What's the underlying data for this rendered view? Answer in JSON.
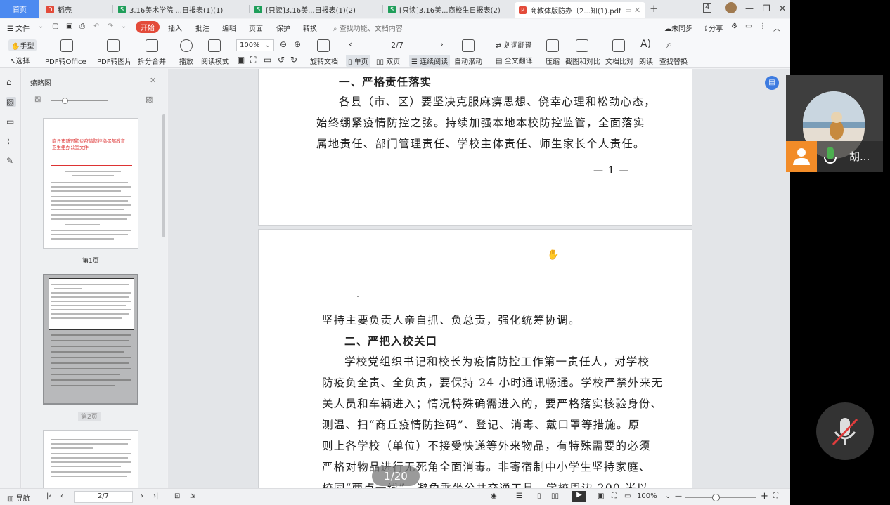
{
  "tabs": [
    {
      "label": "首页",
      "active": false
    },
    {
      "label": "稻壳",
      "active": false
    },
    {
      "label": "3.16美术学院 ...日报表(1)(1)",
      "active": false
    },
    {
      "label": "[只读]3.16美...日报表(1)(2)",
      "active": false
    },
    {
      "label": "[只读]3.16美...商校生日报表(2)",
      "active": false
    },
    {
      "label": "商教体版防办〔2...知(1).pdf",
      "active": true
    }
  ],
  "menubar": {
    "file": "文件",
    "start": "开始",
    "insert": "插入",
    "annotate": "批注",
    "edit": "编辑",
    "page": "页面",
    "protect": "保护",
    "convert": "转换",
    "search_placeholder": "查找功能、文档内容",
    "unsynced": "未同步",
    "share": "分享"
  },
  "toolbar": {
    "hand": "手型",
    "select": "选择",
    "pdf_to_office": "PDF转Office",
    "pdf_to_image": "PDF转图片",
    "split_merge": "拆分合并",
    "play": "播放",
    "read_mode": "阅读模式",
    "zoom": "100%",
    "page_indicator": "2/7",
    "rotate": "旋转文档",
    "single_page": "单页",
    "double_page": "双页",
    "continuous": "连续阅读",
    "auto_scroll": "自动滚动",
    "word_translate": "划词翻译",
    "full_translate": "全文翻译",
    "compress": "压缩",
    "screenshot_compare": "截图和对比",
    "doc_compare": "文档比对",
    "read_aloud": "朗读",
    "find_replace": "查找替换"
  },
  "thumbnails": {
    "title": "缩略图",
    "pages": [
      {
        "label": "第1页",
        "heading": "商丘市新冠肺炎疫情防控指挥部教育卫生组办公室文件"
      },
      {
        "label": "第2页",
        "heading": ""
      },
      {
        "label": "",
        "heading": ""
      }
    ]
  },
  "document": {
    "page1": {
      "heading": "一、严格责任落实",
      "lines": [
        "各县（市、区）要坚决克服麻痹思想、侥幸心理和松劲心态，",
        "始终绷紧疫情防控之弦。持续加强本地本校防控监管，全面落实",
        "属地责任、部门管理责任、学校主体责任、师生家长个人责任。"
      ],
      "page_number": "— 1 —"
    },
    "page2": {
      "lines_before": [
        "坚持主要负责人亲自抓、负总责，强化统筹协调。"
      ],
      "heading": "二、严把入校关口",
      "lines": [
        "学校党组织书记和校长为疫情防控工作第一责任人，对学校",
        "防疫负全责、全负责，要保持 24 小时通讯畅通。学校严禁外来无",
        "关人员和车辆进入；情况特殊确需进入的，要严格落实核验身份、",
        "测温、扫“商丘疫情防控码”、登记、消毒、戴口罩等措施。原",
        "则上各学校（单位）不接受快递等外来物品，有特殊需要的必须",
        "严格对物品进行无死角全面消毒。非寄宿制中小学生坚持家庭、",
        "校园“两点一线”，避免乘坐公共交通工具，学校周边 200 米以"
      ]
    }
  },
  "status": {
    "nav": "导航",
    "page": "2/7",
    "zoom": "100%"
  },
  "overlay": {
    "page_counter": "1/20"
  },
  "video": {
    "participant": "胡..."
  },
  "colors": {
    "accent": "#4c8af0",
    "start_red": "#e34b3a",
    "mic_green": "#4caf50",
    "user_orange": "#f28c28"
  }
}
